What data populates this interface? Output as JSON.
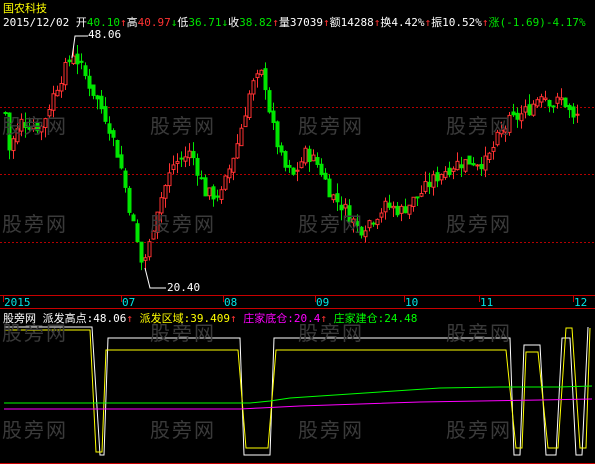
{
  "header": {
    "stock_name": "国农科技",
    "date": "2015/12/02",
    "open_label": "开",
    "open_value": "40.10",
    "high_label": "高",
    "high_value": "40.97",
    "low_label": "低",
    "low_value": "36.71",
    "close_label": "收",
    "close_value": "38.82",
    "volume_label": "量",
    "volume_value": "37039",
    "amount_label": "额",
    "amount_value": "14288",
    "turnover_label": "换",
    "turnover_value": "4.42%",
    "amplitude_label": "振",
    "amplitude_value": "10.52%",
    "change_label": "涨",
    "change_value": "(-1.69)-4.17%"
  },
  "annotations": {
    "max_price": "48.06",
    "min_price": "20.40"
  },
  "time_axis": {
    "labels": [
      "2015",
      "07",
      "08",
      "09",
      "10",
      "11",
      "12"
    ]
  },
  "indicator": {
    "name": "股旁网",
    "high_label": "派发高点",
    "high_value": "48.06",
    "zone_label": "派发区域",
    "zone_value": "39.409",
    "bottom_label": "庄家底仓",
    "bottom_value": "20.4",
    "build_label": "庄家建仓",
    "build_value": "24.48"
  },
  "watermark": "股旁网",
  "colors": {
    "background": "#000000",
    "up": "#ff3232",
    "down": "#00e600",
    "grid": "#b40000",
    "axis": "#c80000",
    "yellow": "#ffff00",
    "white": "#ffffff",
    "magenta": "#ff00ff",
    "green_line": "#00ff00",
    "cyan": "#00e6e6"
  },
  "chart_data": {
    "type": "candlestick",
    "price_max": 48.06,
    "price_min": 20.4,
    "indicator_series": [
      {
        "name": "派发高点",
        "value": 48.06
      },
      {
        "name": "派发区域",
        "value": 39.409
      },
      {
        "name": "庄家底仓",
        "value": 20.4
      },
      {
        "name": "庄家建仓",
        "value": 24.48
      }
    ]
  }
}
